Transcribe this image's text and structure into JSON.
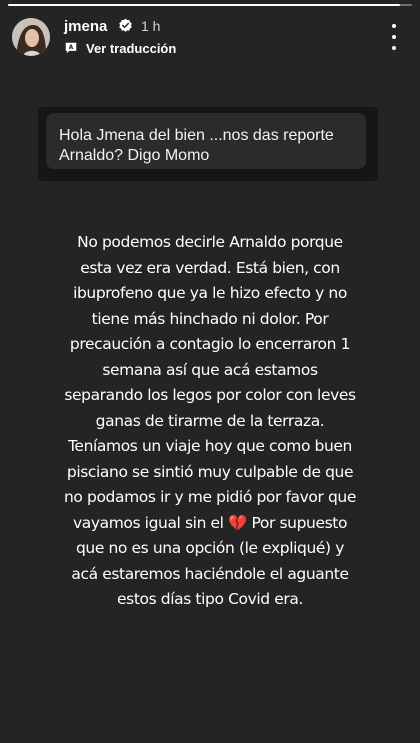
{
  "story": {
    "progress": 0.97
  },
  "header": {
    "username": "jmena",
    "time": "1 h",
    "translate_label": "Ver traducción",
    "icons": [
      "verified-badge-icon",
      "translate-icon",
      "more-options-icon"
    ]
  },
  "question": {
    "text": "Hola Jmena del bien ...nos das reporte Arnaldo? Digo Momo"
  },
  "body": {
    "text_before_emoji": "No podemos decirle Arnaldo porque esta vez era verdad. Está bien, con ibuprofeno que ya le hizo efecto y no tiene más hinchado ni dolor. Por precaución a contagio lo encerraron 1 semana así que acá estamos separando los legos por color con leves ganas de tirarme de la terraza. Teníamos un viaje hoy que como buen pisciano se sintió muy culpable de que no podamos ir y me pidió por favor que vayamos igual sin el",
    "emoji": "💔",
    "text_after_emoji": "Por supuesto que no es una opción (le expliqué) y acá estaremos haciéndole el aguante estos días tipo Covid era."
  },
  "colors": {
    "background": "#242424",
    "question_box": "#161616",
    "question_inner": "#2b2b2b",
    "verified_blue": "#3797f0"
  }
}
